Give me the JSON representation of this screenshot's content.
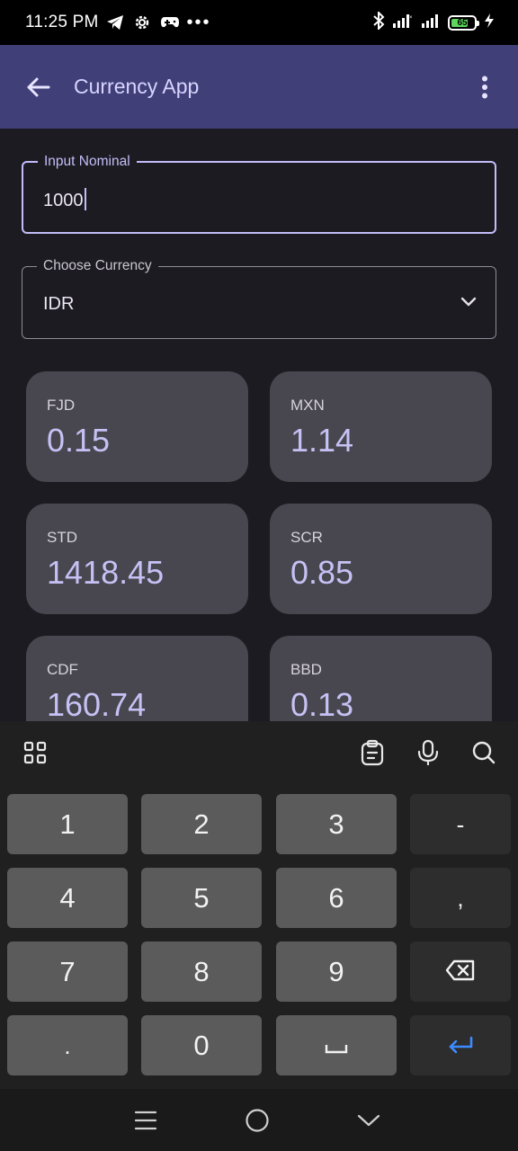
{
  "status_bar": {
    "time": "11:25 PM",
    "overflow": "•••",
    "battery": "65",
    "icons": [
      "telegram-icon",
      "gear-icon",
      "gamepad-icon",
      "bluetooth-icon",
      "signal-icon",
      "signal-icon",
      "battery-icon",
      "charging-icon"
    ]
  },
  "app_bar": {
    "title": "Currency App",
    "back_icon": "arrow-back-icon",
    "menu_icon": "more-vert-icon",
    "background": "#403f78"
  },
  "form": {
    "nominal_label": "Input Nominal",
    "nominal_value": "1000",
    "currency_label": "Choose Currency",
    "currency_value": "IDR"
  },
  "rates": [
    {
      "code": "FJD",
      "value": "0.15"
    },
    {
      "code": "MXN",
      "value": "1.14"
    },
    {
      "code": "STD",
      "value": "1418.45"
    },
    {
      "code": "SCR",
      "value": "0.85"
    },
    {
      "code": "CDF",
      "value": "160.74"
    },
    {
      "code": "BBD",
      "value": "0.13"
    }
  ],
  "keyboard": {
    "toolbar": [
      "grid-icon",
      "clipboard-icon",
      "mic-icon",
      "search-icon"
    ],
    "keys": {
      "k1": "1",
      "k2": "2",
      "k3": "3",
      "dash": "-",
      "k4": "4",
      "k5": "5",
      "k6": "6",
      "comma": ",",
      "k7": "7",
      "k8": "8",
      "k9": "9",
      "dot": ".",
      "k0": "0",
      "space": "␣"
    },
    "accent": "#3c8cff"
  },
  "nav_bar": {
    "icons": [
      "menu-icon",
      "home-icon",
      "back-chevron-icon"
    ]
  }
}
